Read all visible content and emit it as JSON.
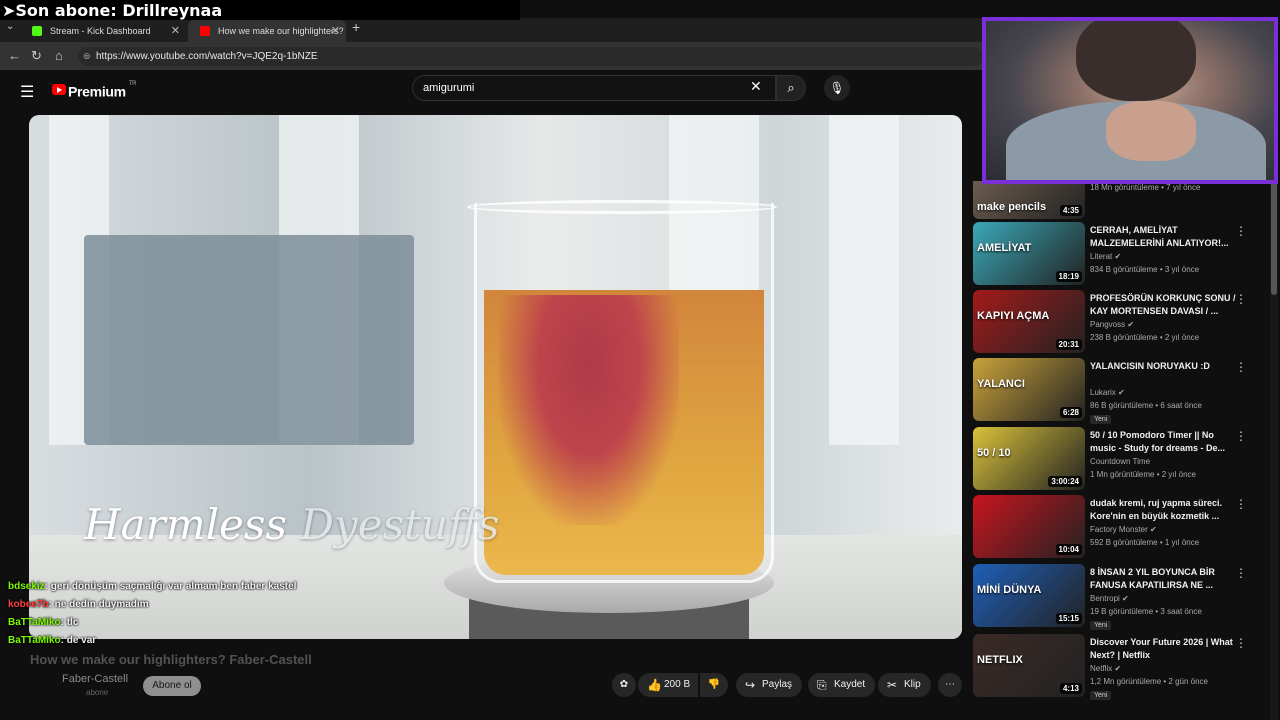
{
  "overlay": {
    "title": "➤Son abone: Drillreynaa"
  },
  "browser": {
    "tabs": [
      {
        "label": "Stream - Kick Dashboard",
        "favicon_color": "#53fc18"
      },
      {
        "label": "How we make our highlighters? Fa",
        "favicon_color": "#ff0000"
      }
    ],
    "url": "https://www.youtube.com/watch?v=JQE2q-1bNZE"
  },
  "youtube": {
    "logo_text": "Premium",
    "logo_region": "TR",
    "search_value": "amigurumi",
    "video": {
      "caption_a": "Harmless",
      "caption_b": "Dyestuffs",
      "title": "How we make our highlighters? Faber-Castell",
      "channel": "Faber-Castell",
      "subs": "abone",
      "subscribe_label": "Abone ol",
      "likes": "200 B",
      "share_label": "Paylaş",
      "save_label": "Kaydet",
      "clip_label": "Klip"
    },
    "recommendations": [
      {
        "thumb_text": "make pencils",
        "duration": "4:35",
        "title": "",
        "channel": "",
        "stats": "18 Mn görüntüleme • 7 yıl önce",
        "badge": "",
        "thumb_color": "#6b5c4e"
      },
      {
        "thumb_text": "AMELİYAT",
        "duration": "18:19",
        "title": "CERRAH, AMELİYAT MALZEMELERİNİ ANLATIYOR!...",
        "channel": "Literat ✔",
        "stats": "834 B görüntüleme • 3 yıl önce",
        "badge": "",
        "thumb_color": "#3aa8b8"
      },
      {
        "thumb_text": "KAPIYI AÇMA",
        "duration": "20:31",
        "title": "PROFESÖRÜN KORKUNÇ SONU / KAY MORTENSEN DAVASI / ...",
        "channel": "Pangvoss ✔",
        "stats": "238 B görüntüleme • 2 yıl önce",
        "badge": "",
        "thumb_color": "#a31a1a"
      },
      {
        "thumb_text": "YALANCI",
        "duration": "6:28",
        "title": "YALANCISIN NORUYAKU :D",
        "channel": "Lukarix ✔",
        "stats": "86 B görüntüleme • 6 saat önce",
        "badge": "Yeni",
        "thumb_color": "#c9a23a"
      },
      {
        "thumb_text": "50 / 10",
        "duration": "3:00:24",
        "title": "50 / 10 Pomodoro Timer || No music - Study for dreams - De...",
        "channel": "Countdown Time",
        "stats": "1 Mn görüntüleme • 2 yıl önce",
        "badge": "",
        "thumb_color": "#d9c23a"
      },
      {
        "thumb_text": "",
        "duration": "10:04",
        "title": "dudak kremi, ruj yapma süreci. Kore'nin en büyük kozmetik ...",
        "channel": "Factory Monster ✔",
        "stats": "592 B görüntüleme • 1 yıl önce",
        "badge": "",
        "thumb_color": "#c8141e"
      },
      {
        "thumb_text": "MİNİ DÜNYA",
        "duration": "15:15",
        "title": "8 İNSAN 2 YIL BOYUNCA BİR FANUSA KAPATILIRSA NE ...",
        "channel": "Bentropi ✔",
        "stats": "19 B görüntüleme • 3 saat önce",
        "badge": "Yeni",
        "thumb_color": "#1f5fb8"
      },
      {
        "thumb_text": "NETFLIX",
        "duration": "4:13",
        "title": "Discover Your Future 2026 | What Next? | Netflix",
        "channel": "Netflix ✔",
        "stats": "1,2 Mn görüntüleme • 2 gün önce",
        "badge": "Yeni",
        "thumb_color": "#3a2a26"
      }
    ]
  },
  "chat": [
    {
      "user": "bdsekiz",
      "msg": ": geri dönüşüm saçmalığı var almam ben faber kastel",
      "color": "#7cfc00"
    },
    {
      "user": "kobee7b",
      "msg": ": ne dedin duymadım",
      "color": "#ff4040"
    },
    {
      "user": "BaTTaMiko",
      "msg": ": tlc",
      "color": "#7cfc00"
    },
    {
      "user": "BaTTaMiko",
      "msg": ": de var",
      "color": "#7cfc00"
    }
  ],
  "colors": {
    "accent": "#ff0000",
    "webcam_border": "#7a2fd8"
  }
}
